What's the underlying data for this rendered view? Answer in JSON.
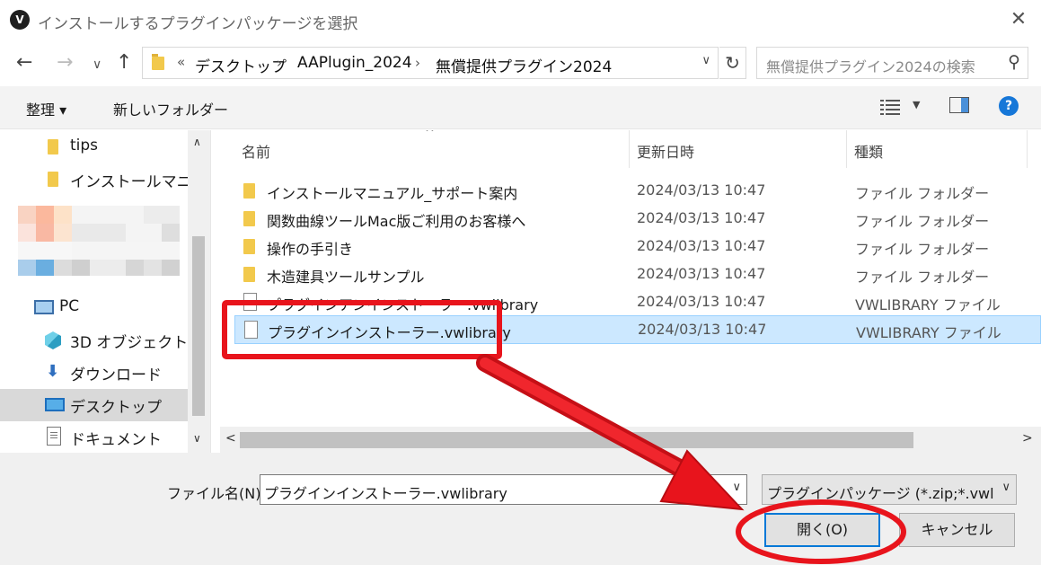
{
  "window": {
    "app_icon": "V",
    "title": "インストールするプラグインパッケージを選択",
    "close_icon": "close-icon"
  },
  "navigation": {
    "back_icon": "←",
    "forward_icon": "→",
    "recent_icon": "∨",
    "up_icon": "↑",
    "overflow": "«",
    "breadcrumb": [
      "デスクトップ",
      "AAPlugin_2024",
      "無償提供プラグイン2024"
    ],
    "refresh_icon": "↻",
    "search_placeholder": "無償提供プラグイン2024の検索"
  },
  "toolbar": {
    "organize_label": "整理 ▾",
    "new_folder_label": "新しいフォルダー",
    "help_label": "?"
  },
  "sidebar": {
    "items": [
      {
        "label": "tips",
        "icon": "folder-icon"
      },
      {
        "label": "インストールマニュアル",
        "icon": "folder-icon"
      },
      {
        "label": "PC",
        "icon": "pc-icon"
      },
      {
        "label": "3D オブジェクト",
        "icon": "3d-objects-icon"
      },
      {
        "label": "ダウンロード",
        "icon": "download-icon"
      },
      {
        "label": "デスクトップ",
        "icon": "desktop-icon",
        "selected": true
      },
      {
        "label": "ドキュメント",
        "icon": "documents-icon"
      }
    ]
  },
  "file_list": {
    "columns": [
      "名前",
      "更新日時",
      "種類"
    ],
    "rows": [
      {
        "name": "インストールマニュアル_サポート案内",
        "date": "2024/03/13 10:47",
        "type": "ファイル フォルダー",
        "icon": "folder-icon"
      },
      {
        "name": "関数曲線ツールMac版ご利用のお客様へ",
        "date": "2024/03/13 10:47",
        "type": "ファイル フォルダー",
        "icon": "folder-icon"
      },
      {
        "name": "操作の手引き",
        "date": "2024/03/13 10:47",
        "type": "ファイル フォルダー",
        "icon": "folder-icon"
      },
      {
        "name": "木造建具ツールサンプル",
        "date": "2024/03/13 10:47",
        "type": "ファイル フォルダー",
        "icon": "folder-icon"
      },
      {
        "name": "プラグインアンインストーラー.vwlibrary",
        "date": "2024/03/13 10:47",
        "type": "VWLIBRARY ファイル",
        "icon": "file-icon"
      },
      {
        "name": "プラグインインストーラー.vwlibrary",
        "date": "2024/03/13 10:47",
        "type": "VWLIBRARY ファイル",
        "icon": "file-icon",
        "selected": true
      }
    ]
  },
  "footer": {
    "filename_label": "ファイル名(N):",
    "filename_value": "プラグインインストーラー.vwlibrary",
    "filter_value": "プラグインパッケージ (*.zip;*.vwlibrary)",
    "open_label": "開く(O)",
    "cancel_label": "キャンセル"
  },
  "colors": {
    "annotation_red": "#e8141c",
    "selection_bg": "#cce8ff",
    "accent_blue": "#0078d7"
  }
}
